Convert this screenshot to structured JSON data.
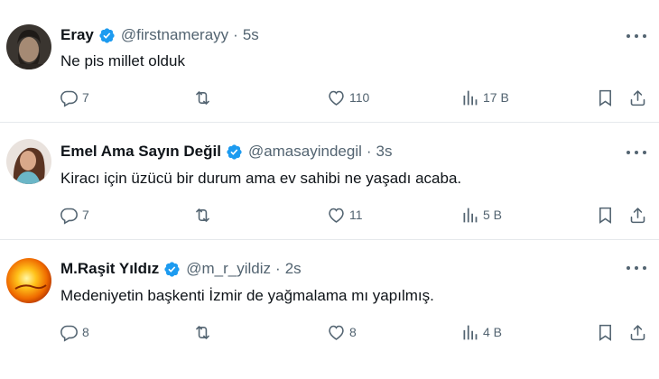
{
  "colors": {
    "verified": "#1d9bf0",
    "secondary": "#536471",
    "text": "#0f1419",
    "divider": "#e6e9ec"
  },
  "icons": {
    "reply": "reply-icon",
    "retweet": "retweet-icon",
    "like": "heart-icon",
    "views": "views-chart-icon",
    "bookmark": "bookmark-icon",
    "share": "share-icon",
    "verified": "verified-badge-icon",
    "more": "more-options-icon"
  },
  "tweets": [
    {
      "name": "Eray",
      "handle": "@firstnamerayy",
      "separator": "·",
      "time": "5s",
      "text": "Ne pis millet olduk",
      "replies": "7",
      "retweets": "",
      "likes": "110",
      "views": "17 B"
    },
    {
      "name": "Emel Ama Sayın Değil",
      "handle": "@amasayindegil",
      "separator": "·",
      "time": "3s",
      "text": "Kiracı için üzücü bir durum ama ev sahibi ne yaşadı acaba.",
      "replies": "7",
      "retweets": "",
      "likes": "11",
      "views": "5 B"
    },
    {
      "name": "M.Raşit Yıldız",
      "handle": "@m_r_yildiz",
      "separator": "·",
      "time": "2s",
      "text": "Medeniyetin başkenti İzmir de yağmalama mı yapılmış.",
      "replies": "8",
      "retweets": "",
      "likes": "8",
      "views": "4 B"
    }
  ]
}
